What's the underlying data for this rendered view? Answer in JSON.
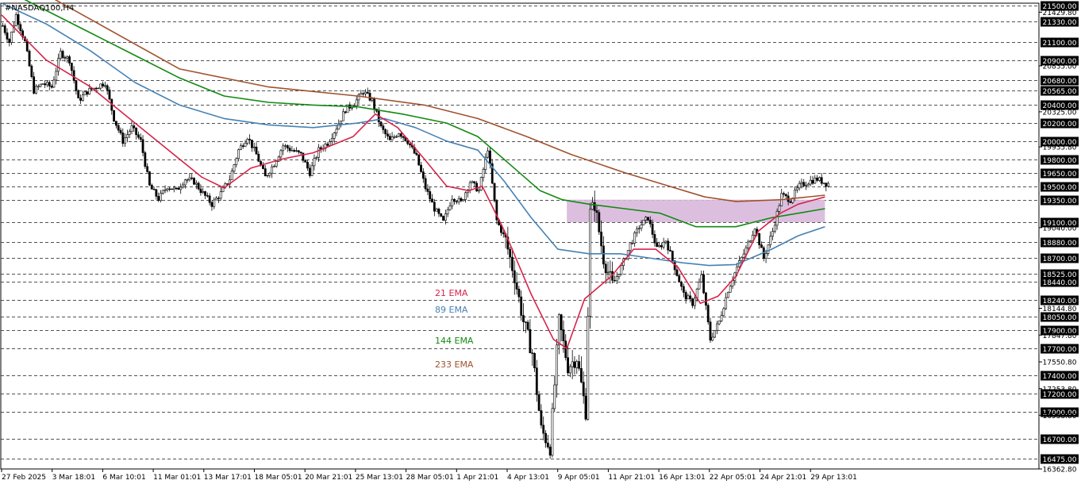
{
  "title": "#NASDAQ100,H4",
  "colors": {
    "background": "#ffffff",
    "grid": "#1a1a1a",
    "candle": "#000000",
    "ema21": "#d7234a",
    "ema89": "#4682b4",
    "ema144": "#138a13",
    "ema233": "#a0522d",
    "zone": "#d8b8dc",
    "box_label_bg": "#000000",
    "box_label_text": "#ffffff"
  },
  "chart_data": {
    "type": "candlestick",
    "title": "#NASDAQ100,H4",
    "ylim": [
      16362.8,
      21530
    ],
    "grid": "dashed horizontal lines at boxed price levels",
    "price_labels_boxed": [
      "21500.00",
      "21330.00",
      "21100.00",
      "20900.00",
      "20680.00",
      "20565.00",
      "20400.00",
      "20200.00",
      "20000.00",
      "19800.00",
      "19650.00",
      "19500.00",
      "19350.00",
      "19100.00",
      "18880.00",
      "18700.00",
      "18525.00",
      "18440.00",
      "18240.00",
      "18050.00",
      "17900.00",
      "17700.00",
      "17400.00",
      "17200.00",
      "17000.00",
      "16700.00",
      "16475.00"
    ],
    "price_labels_plain": [
      "21429.80",
      "20835.00",
      "20325.00",
      "19935.80",
      "19040.00",
      "18144.80",
      "17847.80",
      "17550.80",
      "17253.80",
      "16958.80",
      "16362.80"
    ],
    "x_tick_labels": [
      "27 Feb 2025",
      "3 Mar 18:01",
      "6 Mar 10:01",
      "11 Mar 01:01",
      "13 Mar 17:01",
      "18 Mar 05:01",
      "20 Mar 21:01",
      "25 Mar 13:01",
      "28 Mar 05:01",
      "1 Apr 21:01",
      "4 Apr 13:01",
      "9 Apr 05:01",
      "11 Apr 21:01",
      "16 Apr 13:01",
      "22 Apr 05:01",
      "24 Apr 21:01",
      "29 Apr 13:01"
    ],
    "legend": [
      {
        "label": "21 EMA",
        "color": "#d7234a"
      },
      {
        "label": "89 EMA",
        "color": "#4682b4"
      },
      {
        "label": "144 EMA",
        "color": "#138a13"
      },
      {
        "label": "233 EMA",
        "color": "#a0522d"
      }
    ],
    "zone": {
      "x_start_index": 254,
      "x_end_index": 370,
      "price_low": 19100,
      "price_high": 19350
    },
    "price_path": [
      [
        0,
        21280
      ],
      [
        3,
        21100
      ],
      [
        6,
        21400
      ],
      [
        10,
        21100
      ],
      [
        14,
        20560
      ],
      [
        18,
        20640
      ],
      [
        22,
        20600
      ],
      [
        26,
        20980
      ],
      [
        30,
        20900
      ],
      [
        34,
        20450
      ],
      [
        38,
        20550
      ],
      [
        42,
        20600
      ],
      [
        46,
        20650
      ],
      [
        50,
        20250
      ],
      [
        54,
        20000
      ],
      [
        58,
        20150
      ],
      [
        62,
        20000
      ],
      [
        66,
        19500
      ],
      [
        70,
        19360
      ],
      [
        74,
        19500
      ],
      [
        78,
        19450
      ],
      [
        82,
        19580
      ],
      [
        86,
        19550
      ],
      [
        90,
        19420
      ],
      [
        94,
        19300
      ],
      [
        98,
        19420
      ],
      [
        102,
        19580
      ],
      [
        106,
        19900
      ],
      [
        110,
        20050
      ],
      [
        114,
        19850
      ],
      [
        118,
        19600
      ],
      [
        122,
        19750
      ],
      [
        126,
        19950
      ],
      [
        130,
        19900
      ],
      [
        134,
        19850
      ],
      [
        138,
        19650
      ],
      [
        142,
        19900
      ],
      [
        146,
        19980
      ],
      [
        150,
        20150
      ],
      [
        154,
        20350
      ],
      [
        158,
        20420
      ],
      [
        162,
        20550
      ],
      [
        166,
        20450
      ],
      [
        170,
        20150
      ],
      [
        174,
        20000
      ],
      [
        178,
        20100
      ],
      [
        182,
        20000
      ],
      [
        186,
        19820
      ],
      [
        190,
        19480
      ],
      [
        194,
        19250
      ],
      [
        198,
        19100
      ],
      [
        202,
        19380
      ],
      [
        206,
        19320
      ],
      [
        210,
        19550
      ],
      [
        214,
        19450
      ],
      [
        218,
        19920
      ],
      [
        222,
        19120
      ],
      [
        226,
        18900
      ],
      [
        230,
        18500
      ],
      [
        234,
        18000
      ],
      [
        238,
        17650
      ],
      [
        242,
        16800
      ],
      [
        246,
        16600
      ],
      [
        250,
        18000
      ],
      [
        254,
        17500
      ],
      [
        258,
        17600
      ],
      [
        262,
        17000
      ],
      [
        264,
        19200
      ],
      [
        266,
        19300
      ],
      [
        270,
        18700
      ],
      [
        274,
        18400
      ],
      [
        278,
        18600
      ],
      [
        282,
        18850
      ],
      [
        286,
        19050
      ],
      [
        290,
        19150
      ],
      [
        294,
        18800
      ],
      [
        298,
        18900
      ],
      [
        302,
        18600
      ],
      [
        306,
        18300
      ],
      [
        310,
        18200
      ],
      [
        314,
        18500
      ],
      [
        318,
        17800
      ],
      [
        322,
        18000
      ],
      [
        326,
        18350
      ],
      [
        330,
        18600
      ],
      [
        334,
        18800
      ],
      [
        338,
        19050
      ],
      [
        342,
        18700
      ],
      [
        346,
        19000
      ],
      [
        350,
        19400
      ],
      [
        354,
        19350
      ],
      [
        358,
        19500
      ],
      [
        362,
        19550
      ],
      [
        366,
        19580
      ],
      [
        370,
        19530
      ]
    ],
    "ema21": [
      [
        0,
        21400
      ],
      [
        20,
        20900
      ],
      [
        40,
        20600
      ],
      [
        60,
        20200
      ],
      [
        75,
        19900
      ],
      [
        90,
        19600
      ],
      [
        100,
        19480
      ],
      [
        112,
        19700
      ],
      [
        126,
        19800
      ],
      [
        140,
        19870
      ],
      [
        158,
        20050
      ],
      [
        168,
        20300
      ],
      [
        178,
        20150
      ],
      [
        190,
        19800
      ],
      [
        200,
        19500
      ],
      [
        210,
        19450
      ],
      [
        216,
        19500
      ],
      [
        226,
        19000
      ],
      [
        238,
        18300
      ],
      [
        248,
        17800
      ],
      [
        254,
        17700
      ],
      [
        262,
        18250
      ],
      [
        274,
        18500
      ],
      [
        284,
        18800
      ],
      [
        294,
        18800
      ],
      [
        304,
        18600
      ],
      [
        314,
        18200
      ],
      [
        322,
        18280
      ],
      [
        330,
        18500
      ],
      [
        340,
        19000
      ],
      [
        350,
        19200
      ],
      [
        358,
        19300
      ],
      [
        370,
        19380
      ]
    ],
    "ema89": [
      [
        0,
        21530
      ],
      [
        20,
        21300
      ],
      [
        40,
        21000
      ],
      [
        60,
        20650
      ],
      [
        80,
        20400
      ],
      [
        100,
        20250
      ],
      [
        120,
        20180
      ],
      [
        140,
        20150
      ],
      [
        160,
        20200
      ],
      [
        172,
        20250
      ],
      [
        186,
        20150
      ],
      [
        200,
        20000
      ],
      [
        214,
        19900
      ],
      [
        226,
        19550
      ],
      [
        238,
        19150
      ],
      [
        250,
        18800
      ],
      [
        264,
        18750
      ],
      [
        278,
        18750
      ],
      [
        292,
        18700
      ],
      [
        306,
        18650
      ],
      [
        318,
        18620
      ],
      [
        330,
        18630
      ],
      [
        346,
        18800
      ],
      [
        358,
        18950
      ],
      [
        370,
        19050
      ]
    ],
    "ema144": [
      [
        0,
        21700
      ],
      [
        20,
        21450
      ],
      [
        40,
        21200
      ],
      [
        60,
        20950
      ],
      [
        80,
        20700
      ],
      [
        100,
        20500
      ],
      [
        120,
        20430
      ],
      [
        140,
        20400
      ],
      [
        160,
        20380
      ],
      [
        180,
        20300
      ],
      [
        200,
        20200
      ],
      [
        214,
        20050
      ],
      [
        228,
        19750
      ],
      [
        242,
        19450
      ],
      [
        252,
        19350
      ],
      [
        264,
        19300
      ],
      [
        280,
        19250
      ],
      [
        296,
        19200
      ],
      [
        312,
        19050
      ],
      [
        330,
        19050
      ],
      [
        346,
        19150
      ],
      [
        358,
        19200
      ],
      [
        370,
        19250
      ]
    ],
    "ema233": [
      [
        0,
        21900
      ],
      [
        40,
        21350
      ],
      [
        80,
        20800
      ],
      [
        120,
        20600
      ],
      [
        160,
        20500
      ],
      [
        190,
        20400
      ],
      [
        214,
        20250
      ],
      [
        236,
        20050
      ],
      [
        256,
        19850
      ],
      [
        280,
        19650
      ],
      [
        300,
        19500
      ],
      [
        316,
        19380
      ],
      [
        330,
        19330
      ],
      [
        350,
        19350
      ],
      [
        370,
        19400
      ]
    ]
  }
}
